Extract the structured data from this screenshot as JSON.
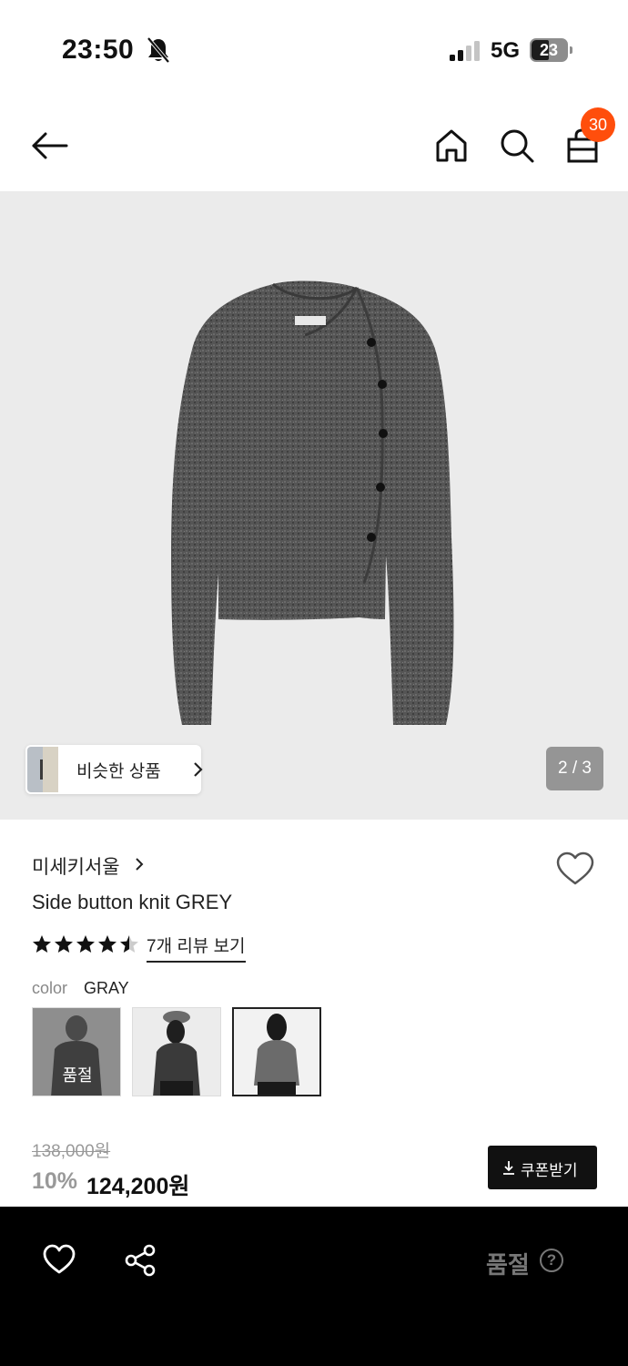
{
  "status_bar": {
    "time": "23:50",
    "network": "5G",
    "battery": "23"
  },
  "header": {
    "cart_count": "30"
  },
  "gallery": {
    "similar_label": "비슷한 상품",
    "page_indicator": "2 / 3"
  },
  "product": {
    "brand": "미세키서울",
    "name": "Side button knit GREY",
    "rating": 4.5,
    "review_link": "7개 리뷰 보기",
    "color_label": "color",
    "color_value": "GRAY",
    "swatches": [
      {
        "sold_out_label": "품절",
        "selected": false
      },
      {
        "selected": false
      },
      {
        "selected": true
      }
    ],
    "original_price": "138,000원",
    "discount": "10%",
    "sale_price": "124,200원",
    "coupon_label": "쿠폰받기"
  },
  "bottom_bar": {
    "status": "품절",
    "help": "?"
  },
  "colors": {
    "cart_badge": "#ff4e0c",
    "sweater": "#555555",
    "bottom_bar": "#000000"
  }
}
